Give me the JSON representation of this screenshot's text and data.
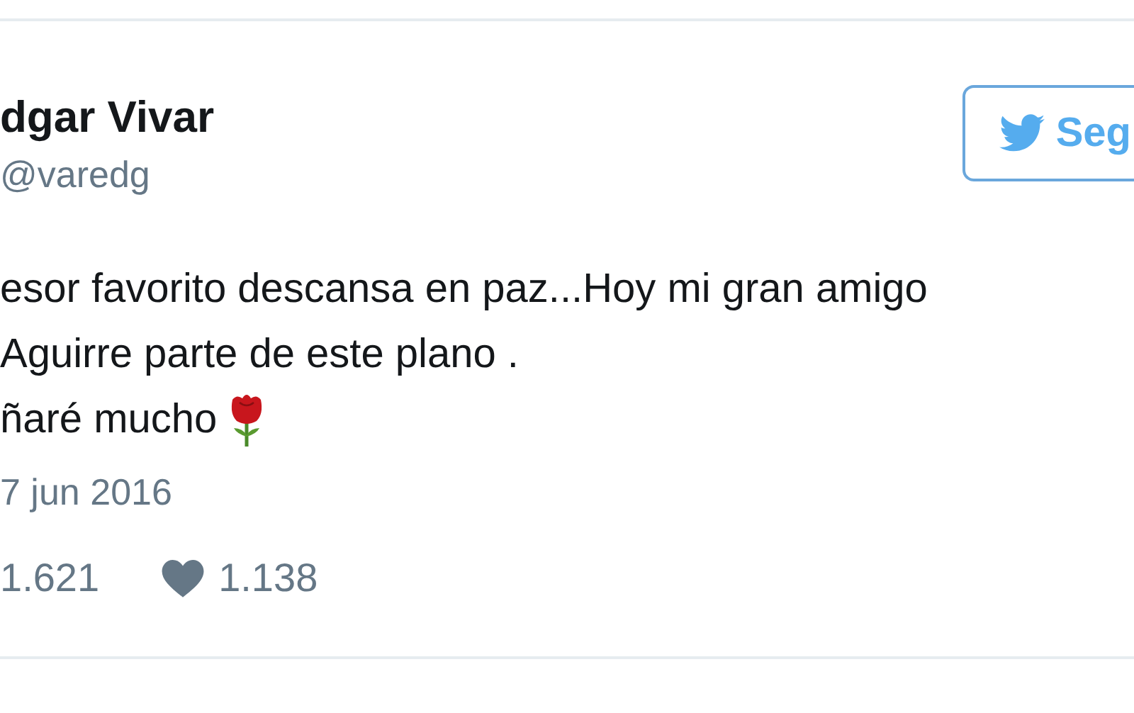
{
  "author": {
    "name": "dgar Vivar",
    "handle": "@varedg"
  },
  "follow_button": {
    "label": "Seg"
  },
  "text_lines": [
    "esor favorito descansa en paz...Hoy mi gran amigo",
    "Aguirre parte de este plano .",
    "ñaré mucho"
  ],
  "date": "7 jun 2016",
  "stats": {
    "retweets": "1.621",
    "likes": "1.138"
  }
}
